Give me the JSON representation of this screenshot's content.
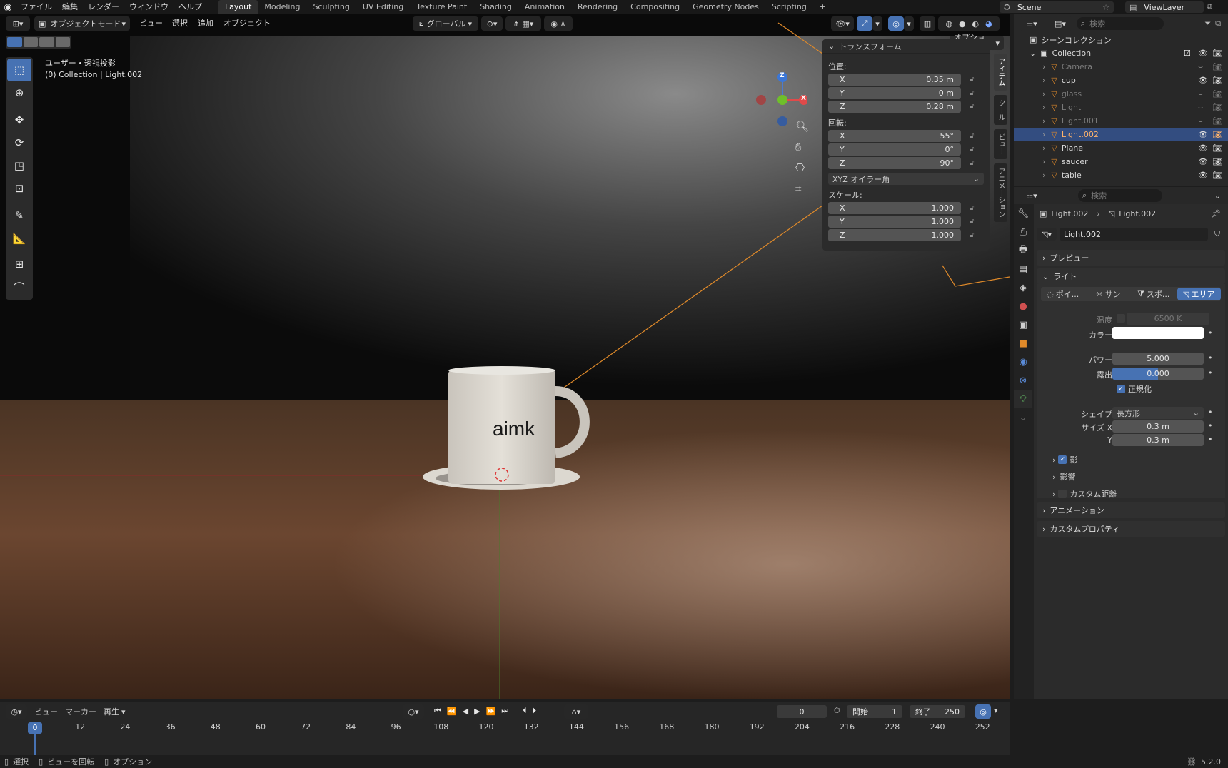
{
  "topbar": {
    "menus": [
      "ファイル",
      "編集",
      "レンダー",
      "ウィンドウ",
      "ヘルプ"
    ],
    "workspaces": [
      "Layout",
      "Modeling",
      "Sculpting",
      "UV Editing",
      "Texture Paint",
      "Shading",
      "Animation",
      "Rendering",
      "Compositing",
      "Geometry Nodes",
      "Scripting"
    ],
    "active_workspace": "Layout",
    "add_workspace": "+",
    "scene": "Scene",
    "view_layer": "ViewLayer"
  },
  "viewport_header": {
    "mode": "オブジェクトモード",
    "menus": [
      "ビュー",
      "選択",
      "追加",
      "オブジェクト"
    ],
    "orientation": "グローバル",
    "options": "オプション"
  },
  "viewport_overlay": {
    "view_name": "ユーザー・透視投影",
    "collection_info": "(0) Collection | Light.002",
    "mug_text": "aimk"
  },
  "gizmo": {
    "x": "X",
    "y": "Y",
    "z": "Z"
  },
  "npanel": {
    "title": "トランスフォーム",
    "location_label": "位置:",
    "location": [
      {
        "axis": "X",
        "value": "0.35 m"
      },
      {
        "axis": "Y",
        "value": "0 m"
      },
      {
        "axis": "Z",
        "value": "0.28 m"
      }
    ],
    "rotation_label": "回転:",
    "rotation": [
      {
        "axis": "X",
        "value": "55°"
      },
      {
        "axis": "Y",
        "value": "0°"
      },
      {
        "axis": "Z",
        "value": "90°"
      }
    ],
    "rotation_mode": "XYZ オイラー角",
    "scale_label": "スケール:",
    "scale": [
      {
        "axis": "X",
        "value": "1.000"
      },
      {
        "axis": "Y",
        "value": "1.000"
      },
      {
        "axis": "Z",
        "value": "1.000"
      }
    ],
    "tabs": [
      "アイテム",
      "ツール",
      "ビュー",
      "アニメーション"
    ]
  },
  "outliner": {
    "search_placeholder": "検索",
    "scene_collection": "シーンコレクション",
    "collection": "Collection",
    "items": [
      {
        "name": "Camera",
        "visible": false,
        "selected": false
      },
      {
        "name": "cup",
        "visible": true,
        "selected": false
      },
      {
        "name": "glass",
        "visible": false,
        "selected": false
      },
      {
        "name": "Light",
        "visible": false,
        "selected": false
      },
      {
        "name": "Light.001",
        "visible": false,
        "selected": false
      },
      {
        "name": "Light.002",
        "visible": true,
        "selected": true
      },
      {
        "name": "Plane",
        "visible": true,
        "selected": false
      },
      {
        "name": "saucer",
        "visible": true,
        "selected": false
      },
      {
        "name": "table",
        "visible": true,
        "selected": false
      }
    ]
  },
  "properties": {
    "search_placeholder": "検索",
    "breadcrumb_object": "Light.002",
    "breadcrumb_data": "Light.002",
    "datablock_name": "Light.002",
    "preview_label": "プレビュー",
    "light_label": "ライト",
    "light_types": [
      "ポイ...",
      "サン",
      "スポ...",
      "エリア"
    ],
    "active_light_type": "エリア",
    "temperature_label": "温度",
    "temperature_value": "6500 K",
    "color_label": "カラー",
    "power_label": "パワー",
    "power_value": "5.000",
    "exposure_label": "露出",
    "exposure_value": "0.000",
    "normalize_label": "正規化",
    "shape_label": "シェイプ",
    "shape_value": "長方形",
    "size_x_label": "サイズ X",
    "size_x_value": "0.3 m",
    "size_y_label": "Y",
    "size_y_value": "0.3 m",
    "shadow_label": "影",
    "influence_label": "影響",
    "custom_distance_label": "カスタム距離",
    "animation_label": "アニメーション",
    "custom_props_label": "カスタムプロパティ"
  },
  "timeline": {
    "menus": [
      "ビュー",
      "マーカー",
      "再生"
    ],
    "current_frame": "0",
    "start_label": "開始",
    "start_value": "1",
    "end_label": "終了",
    "end_value": "250",
    "ticks": [
      "0",
      "12",
      "24",
      "36",
      "48",
      "60",
      "72",
      "84",
      "96",
      "108",
      "120",
      "132",
      "144",
      "156",
      "168",
      "180",
      "192",
      "204",
      "216",
      "228",
      "240",
      "252"
    ]
  },
  "statusbar": {
    "select": "選択",
    "rotate_view": "ビューを回転",
    "options": "オプション",
    "version": "5.2.0"
  },
  "colors": {
    "accent": "#4772b3",
    "selected_orange": "#ffb36a",
    "light_line": "#e08a2a"
  }
}
